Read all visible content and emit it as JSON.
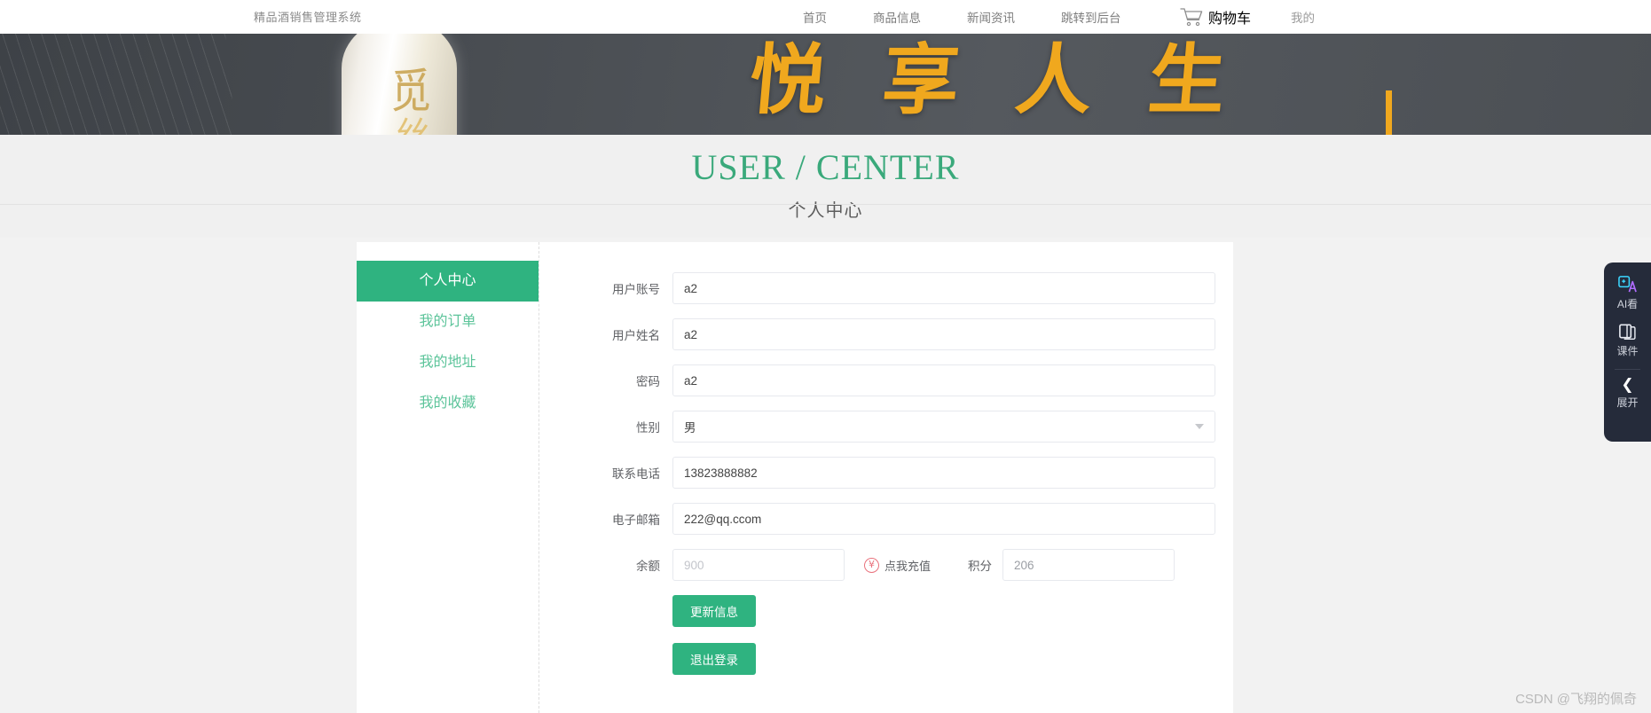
{
  "nav": {
    "brand": "精品酒销售管理系统",
    "links": [
      {
        "label": "首页"
      },
      {
        "label": "商品信息"
      },
      {
        "label": "新闻资讯"
      },
      {
        "label": "跳转到后台"
      }
    ],
    "cart_label": "购物车",
    "cart_icon": "shopping-cart-icon",
    "mine_label": "我的"
  },
  "banner": {
    "slogan": [
      "悦",
      "享",
      "人",
      "生"
    ]
  },
  "header": {
    "title": "USER / CENTER",
    "subtitle": "个人中心",
    "title_color": "#3aa97b"
  },
  "sidebar": {
    "items": [
      {
        "label": "个人中心",
        "active": true
      },
      {
        "label": "我的订单",
        "active": false
      },
      {
        "label": "我的地址",
        "active": false
      },
      {
        "label": "我的收藏",
        "active": false
      }
    ]
  },
  "form": {
    "fields": [
      {
        "label": "用户账号",
        "value": "a2",
        "type": "text"
      },
      {
        "label": "用户姓名",
        "value": "a2",
        "type": "text"
      },
      {
        "label": "密码",
        "value": "a2",
        "type": "password"
      },
      {
        "label": "性别",
        "value": "男",
        "type": "select"
      },
      {
        "label": "联系电话",
        "value": "13823888882",
        "type": "text"
      },
      {
        "label": "电子邮箱",
        "value": "222@qq.ccom",
        "type": "text"
      }
    ],
    "balance": {
      "label": "余额",
      "value": "900",
      "recharge_label": "点我充值",
      "recharge_icon": "yen-circle-icon"
    },
    "points": {
      "label": "积分",
      "value": "206"
    },
    "buttons": [
      {
        "label": "更新信息"
      },
      {
        "label": "退出登录"
      }
    ],
    "accent_color": "#2fb380"
  },
  "floatbar": {
    "items": [
      {
        "label": "AI看",
        "icon": "ai-sparkle-icon"
      },
      {
        "label": "课件",
        "icon": "book-icon"
      },
      {
        "label": "展开",
        "icon": "chevron-left-icon"
      }
    ]
  },
  "watermark": "CSDN @飞翔的佩奇"
}
